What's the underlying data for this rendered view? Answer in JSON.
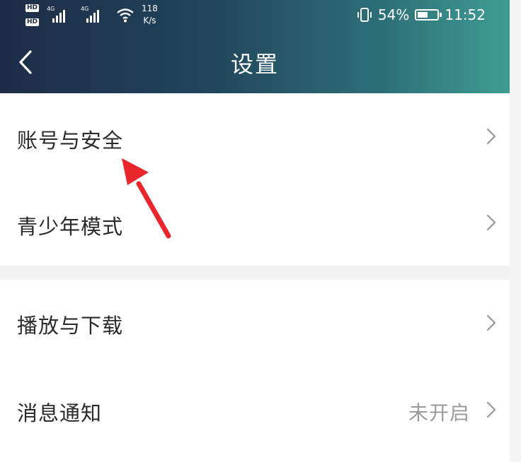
{
  "status_bar": {
    "hd_badge": "HD",
    "network_label": "4G",
    "net_speed_value": "118",
    "net_speed_unit": "K/s",
    "battery_percent": "54%",
    "battery_level": 0.54,
    "time": "11:52"
  },
  "header": {
    "title": "设置"
  },
  "settings": {
    "items": [
      {
        "label": "账号与安全",
        "value": ""
      },
      {
        "label": "青少年模式",
        "value": ""
      },
      {
        "label": "播放与下载",
        "value": ""
      },
      {
        "label": "消息通知",
        "value": "未开启"
      }
    ]
  },
  "colors": {
    "header_start": "#1d2c47",
    "header_end": "#3f9c94",
    "annotation_arrow": "#e8262b",
    "text_primary": "#2a2a2a",
    "text_secondary": "#9b9b9b"
  },
  "icons": {
    "back": "chevron-left-icon",
    "row_chevron": "chevron-right-icon",
    "annotation": "red-arrow-pointer"
  }
}
